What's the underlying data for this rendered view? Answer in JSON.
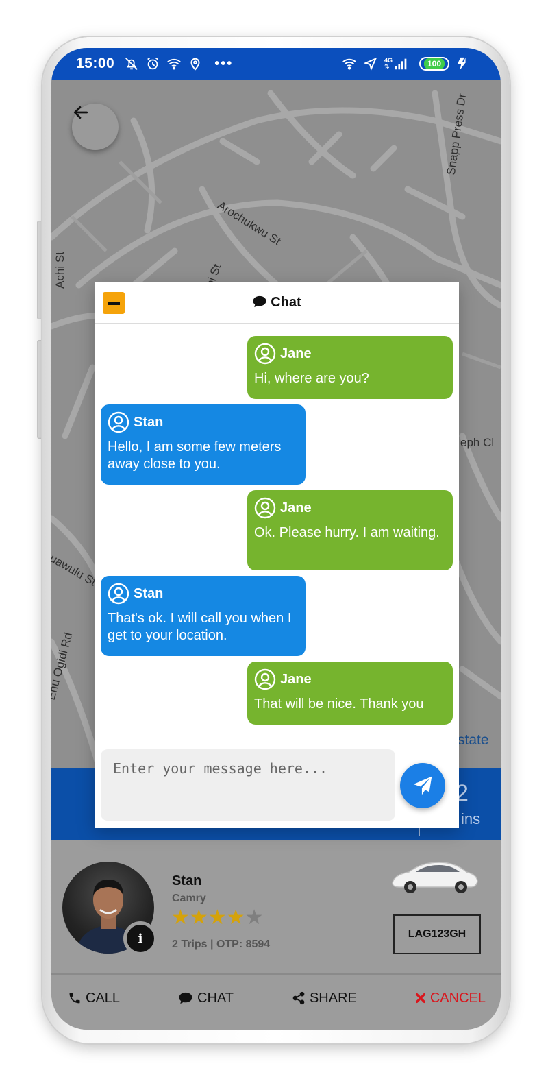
{
  "status_bar": {
    "time": "15:00",
    "left_icons": [
      "bell-off-icon",
      "alarm-icon",
      "wifi-calling-icon",
      "location-pin-icon"
    ],
    "dots": "•••",
    "network": [
      "4G",
      "⇅"
    ],
    "battery": "100"
  },
  "map": {
    "labels": [
      "Snapp Press Dr",
      "Arochukwu St",
      "Achi St",
      "bi St",
      "eph Cl",
      "uawulu St",
      "Enu Ogidi Rd",
      "state"
    ]
  },
  "eta": {
    "number": "2",
    "unit": "ins"
  },
  "chat": {
    "title": "Chat",
    "messages": [
      {
        "sender": "Jane",
        "text": "Hi, where are you?",
        "side": "me"
      },
      {
        "sender": "Stan",
        "text": "Hello, I am some few meters away close to you.",
        "side": "them"
      },
      {
        "sender": "Jane",
        "text": "Ok. Please hurry. I am waiting.",
        "side": "me"
      },
      {
        "sender": "Stan",
        "text": "That's ok. I will call you when I get to your location.",
        "side": "them"
      },
      {
        "sender": "Jane",
        "text": "That will be nice. Thank you",
        "side": "me"
      }
    ],
    "input_placeholder": "Enter your message here...",
    "input_value": ""
  },
  "driver": {
    "name": "Stan",
    "car": "Camry",
    "rating": 4,
    "rating_max": 5,
    "trips_otp": "2 Trips | OTP: 8594",
    "plate": "LAG123GH",
    "info_glyph": "i"
  },
  "actions": {
    "call": "CALL",
    "chat": "CHAT",
    "share": "SHARE",
    "cancel": "CANCEL"
  },
  "colors": {
    "status_bar": "#0b4fbd",
    "my_bubble": "#76b42e",
    "their_bubble": "#1588e3",
    "minimize": "#f5a30a",
    "send": "#1b7fe6",
    "star_on": "#d4a20b",
    "star_off": "#7f7f7f",
    "cancel": "#d9161d"
  }
}
